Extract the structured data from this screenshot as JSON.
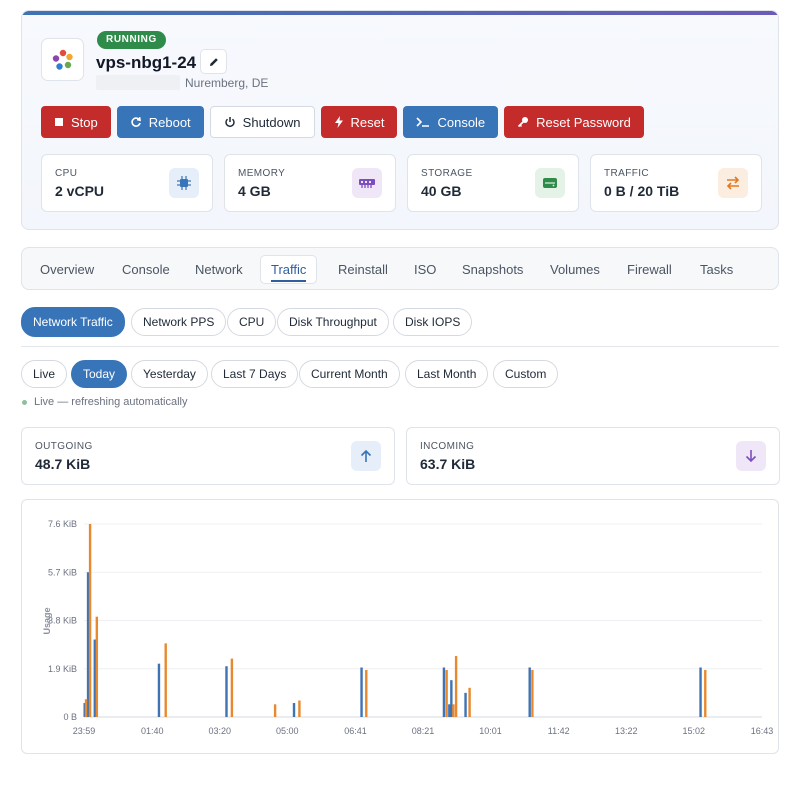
{
  "server": {
    "status": "RUNNING",
    "name": "vps-nbg1-24",
    "location": "Nuremberg, DE"
  },
  "actions": [
    {
      "label": "Stop",
      "icon": "stop-icon",
      "style": "red"
    },
    {
      "label": "Reboot",
      "icon": "reboot-icon",
      "style": "blue"
    },
    {
      "label": "Shutdown",
      "icon": "power-icon",
      "style": "white"
    },
    {
      "label": "Reset",
      "icon": "lightning-icon",
      "style": "red"
    },
    {
      "label": "Console",
      "icon": "terminal-icon",
      "style": "blue"
    },
    {
      "label": "Reset Password",
      "icon": "key-icon",
      "style": "red"
    }
  ],
  "stats": [
    {
      "label": "CPU",
      "value": "2 vCPU",
      "icon": "cpu-icon",
      "color": "#3874b8"
    },
    {
      "label": "MEMORY",
      "value": "4 GB",
      "icon": "memory-icon",
      "color": "#7c4dbd"
    },
    {
      "label": "STORAGE",
      "value": "40 GB",
      "icon": "storage-icon",
      "color": "#2e8b4a"
    },
    {
      "label": "TRAFFIC",
      "value": "0 B / 20 TiB",
      "icon": "transfer-icon",
      "color": "#e07b24"
    }
  ],
  "tabs": [
    "Overview",
    "Console",
    "Network",
    "Traffic",
    "Reinstall",
    "ISO",
    "Snapshots",
    "Volumes",
    "Firewall",
    "Tasks"
  ],
  "active_tab": "Traffic",
  "metric_tabs": [
    "Network Traffic",
    "Network PPS",
    "CPU",
    "Disk Throughput",
    "Disk IOPS"
  ],
  "active_metric": "Network Traffic",
  "ranges": [
    "Live",
    "Today",
    "Yesterday",
    "Last 7 Days",
    "Current Month",
    "Last Month",
    "Custom"
  ],
  "active_range": "Today",
  "live_status": "Live — refreshing automatically",
  "outgoing": {
    "label": "OUTGOING",
    "value": "48.7 KiB",
    "icon": "arrow-up-icon",
    "color": "#3874b8"
  },
  "incoming": {
    "label": "INCOMING",
    "value": "63.7 KiB",
    "icon": "arrow-down-icon",
    "color": "#7c4dbd"
  },
  "colors": {
    "outgoing": "#3f73b4",
    "incoming": "#e8892f"
  },
  "chart_data": {
    "type": "bar",
    "ylabel": "Usage",
    "ylim": [
      0,
      7.6
    ],
    "y_unit": "KiB",
    "y_ticks": [
      "0 B",
      "1.9 KiB",
      "3.8 KiB",
      "5.7 KiB",
      "7.6 KiB"
    ],
    "y_tick_values": [
      0,
      1.9,
      3.8,
      5.7,
      7.6
    ],
    "x_ticks": [
      "23:59",
      "01:40",
      "03:20",
      "05:00",
      "06:41",
      "08:21",
      "10:01",
      "11:42",
      "13:22",
      "15:02",
      "16:43"
    ],
    "x_tick_minutes": [
      1439,
      100,
      200,
      300,
      401,
      501,
      601,
      702,
      802,
      902,
      1003
    ],
    "series": [
      {
        "name": "Outgoing",
        "points": [
          {
            "t": "00:00",
            "v": 0.55
          },
          {
            "t": "00:05",
            "v": 5.7
          },
          {
            "t": "00:15",
            "v": 3.05
          },
          {
            "t": "01:50",
            "v": 2.1
          },
          {
            "t": "03:30",
            "v": 2.0
          },
          {
            "t": "05:10",
            "v": 0.55
          },
          {
            "t": "06:50",
            "v": 1.95
          },
          {
            "t": "08:52",
            "v": 1.95
          },
          {
            "t": "09:00",
            "v": 0.5
          },
          {
            "t": "09:03",
            "v": 1.45
          },
          {
            "t": "09:24",
            "v": 0.95
          },
          {
            "t": "10:59",
            "v": 1.95
          },
          {
            "t": "15:12",
            "v": 1.95
          }
        ]
      },
      {
        "name": "Incoming",
        "points": [
          {
            "t": "00:02",
            "v": 0.7
          },
          {
            "t": "00:08",
            "v": 7.6
          },
          {
            "t": "00:18",
            "v": 3.95
          },
          {
            "t": "02:00",
            "v": 2.9
          },
          {
            "t": "03:38",
            "v": 2.3
          },
          {
            "t": "04:42",
            "v": 0.5
          },
          {
            "t": "05:18",
            "v": 0.65
          },
          {
            "t": "06:57",
            "v": 1.85
          },
          {
            "t": "08:56",
            "v": 1.85
          },
          {
            "t": "09:06",
            "v": 0.5
          },
          {
            "t": "09:10",
            "v": 2.4
          },
          {
            "t": "09:30",
            "v": 1.15
          },
          {
            "t": "11:03",
            "v": 1.85
          },
          {
            "t": "15:19",
            "v": 1.85
          }
        ]
      }
    ]
  }
}
